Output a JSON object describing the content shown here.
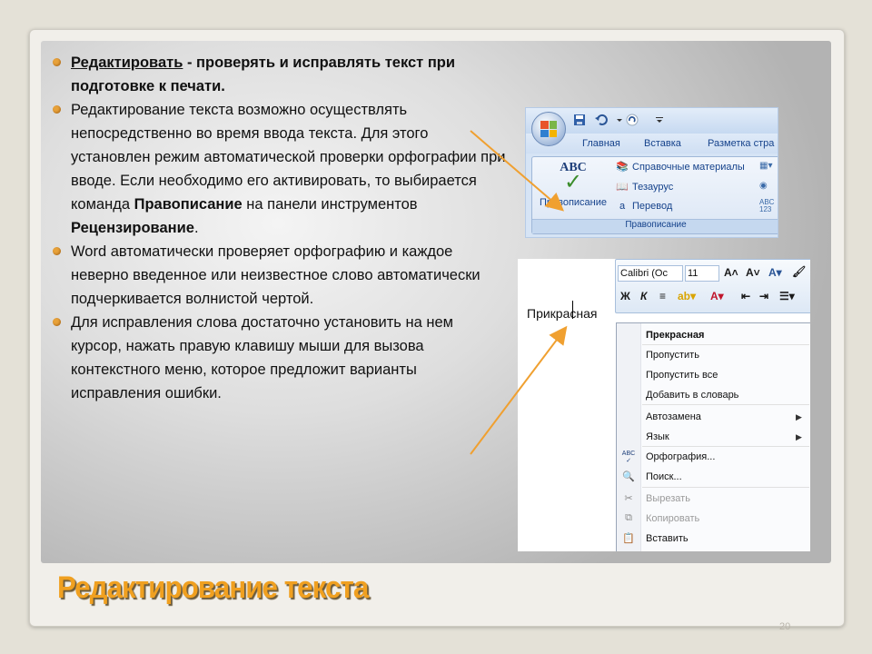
{
  "slide": {
    "title": "Редактирование текста",
    "page_number": "20"
  },
  "bullets": [
    {
      "term": "Редактировать",
      "text": " - проверять и исправлять текст при подготовке к печати."
    },
    {
      "text1": "Редактирование текста возможно  осуществлять непосредственно во время ввода текста. Для этого установлен режим автоматической проверки орфографии при вводе. Если необходимо его активировать, то выбирается команда ",
      "cmd": "Правописание",
      "text2": " на панели инструментов ",
      "panel": "Рецензирование",
      "text3": "."
    },
    {
      "text": "Word автоматически проверяет орфографию и каждое неверно введенное или неизвестное слово автоматически подчеркивается волнистой чертой."
    },
    {
      "text": "Для исправления слова достаточно установить на нем курсор, нажать правую клавишу мыши для вызова контекстного меню, которое предложит варианты исправления ошибки."
    }
  ],
  "ribbon": {
    "tabs": [
      "Главная",
      "Вставка",
      "Разметка стра"
    ],
    "big_button": {
      "icon_text": "ABC",
      "label": "Правописание"
    },
    "rows": [
      "Справочные материалы",
      "Тезаурус",
      "Перевод"
    ],
    "translate_icon": "a",
    "small_icon_label": "ABC\n123",
    "group_label": "Правописание"
  },
  "context": {
    "font_name": "Calibri (Ос",
    "font_size": "11",
    "word": "Прикрасная",
    "menu_items": [
      {
        "label": "Прекрасная",
        "style": "bold"
      },
      {
        "label": "Пропустить"
      },
      {
        "label": "Пропустить все"
      },
      {
        "label": "Добавить в словарь"
      },
      {
        "label": "Автозамена",
        "submenu": true
      },
      {
        "label": "Язык",
        "submenu": true
      },
      {
        "label": "Орфография..."
      },
      {
        "label": "Поиск..."
      },
      {
        "label": "Вырезать",
        "disabled": true
      },
      {
        "label": "Копировать",
        "disabled": true
      },
      {
        "label": "Вставить"
      }
    ]
  },
  "colors": {
    "accent": "#f0a020",
    "arrow": "#f0a030",
    "bullet": "#e8a23a"
  }
}
